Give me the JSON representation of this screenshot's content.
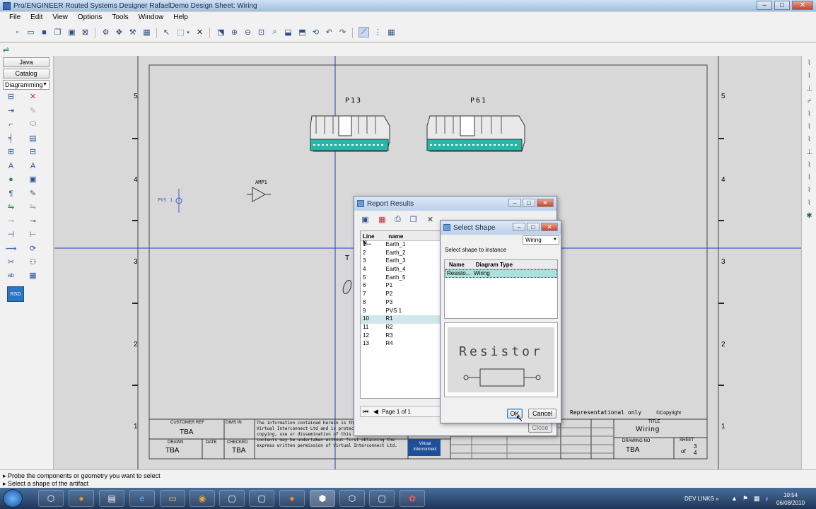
{
  "window": {
    "title": "Pro/ENGINEER Routed Systems Designer RafaelDemo Design Sheet: Wiring",
    "controls": [
      "–",
      "□",
      "✕"
    ]
  },
  "menu": [
    "File",
    "Edit",
    "View",
    "Options",
    "Tools",
    "Window",
    "Help"
  ],
  "left_panel": {
    "java_label": "Java",
    "catalog_label": "Catalog",
    "mode_select": "Diagramming",
    "rsd_badge": "RSD"
  },
  "drawing": {
    "row_markers": [
      "5",
      "4",
      "3",
      "2",
      "1"
    ],
    "connectors": [
      "P13",
      "P61"
    ],
    "component_labels": {
      "amp": "AMP1",
      "pvs": "PVS 1",
      "t_label": "T"
    },
    "title_block": {
      "customer_ref_label": "CUSTOMER REF",
      "customer_ref_value": "TBA",
      "dims_in_label": "DIMS IN",
      "drawn_label": "DRAWN",
      "drawn_value": "TBA",
      "date_label": "DATE",
      "checked_label": "CHECKED",
      "checked_value": "TBA",
      "disclaimer": "The information contained herein is the property of Virtual Interconnect Ltd and is protected by law. No copying, use or dissemination of this document or its contents may be undertaken without first obtaining the express written permission of Virtual Interconnect Ltd.",
      "logo_text": "Virtual Interconnect",
      "representational": "Representational only",
      "copyright": "©Copyright",
      "title_label": "TITLE",
      "title_value": "Wiring",
      "drawing_no_label": "DRAWING NO",
      "drawing_no_value": "TBA",
      "sheet_label": "SHEET",
      "sheet_value": "3",
      "sheet_of": "of",
      "sheet_total": "4"
    }
  },
  "report_results": {
    "title": "Report Results",
    "columns": [
      "Line N...",
      "name"
    ],
    "rows": [
      {
        "n": "1",
        "name": "Earth_1"
      },
      {
        "n": "2",
        "name": "Earth_2"
      },
      {
        "n": "3",
        "name": "Earth_3"
      },
      {
        "n": "4",
        "name": "Earth_4"
      },
      {
        "n": "5",
        "name": "Earth_5"
      },
      {
        "n": "6",
        "name": "P1"
      },
      {
        "n": "7",
        "name": "P2"
      },
      {
        "n": "8",
        "name": "P3"
      },
      {
        "n": "9",
        "name": "PVS 1"
      },
      {
        "n": "10",
        "name": "R1"
      },
      {
        "n": "11",
        "name": "R2"
      },
      {
        "n": "12",
        "name": "R3"
      },
      {
        "n": "13",
        "name": "R4"
      }
    ],
    "selected_row": "10",
    "page_label": "Page 1 of 1",
    "close_label": "Close"
  },
  "select_shape": {
    "title": "Select Shape",
    "filter_value": "Wiring",
    "instruction": "Select shape to instance",
    "columns": [
      "Name",
      "Diagram Type"
    ],
    "rows": [
      {
        "name": "Resisto...",
        "type": "Wiring"
      }
    ],
    "preview_text": "Resistor",
    "ok_label": "OK",
    "cancel_label": "Cancel"
  },
  "status": {
    "line1": "Probe the components or geometry you want to select",
    "line2": "Select a shape of the artifact"
  },
  "taskbar": {
    "tray_label": "DEV LINKS",
    "time": "10:54",
    "date": "06/08/2010"
  },
  "colors": {
    "crosshair": "#2a3db5",
    "connector_pins": "#25b8a8",
    "selection": "#cfe8ea"
  }
}
